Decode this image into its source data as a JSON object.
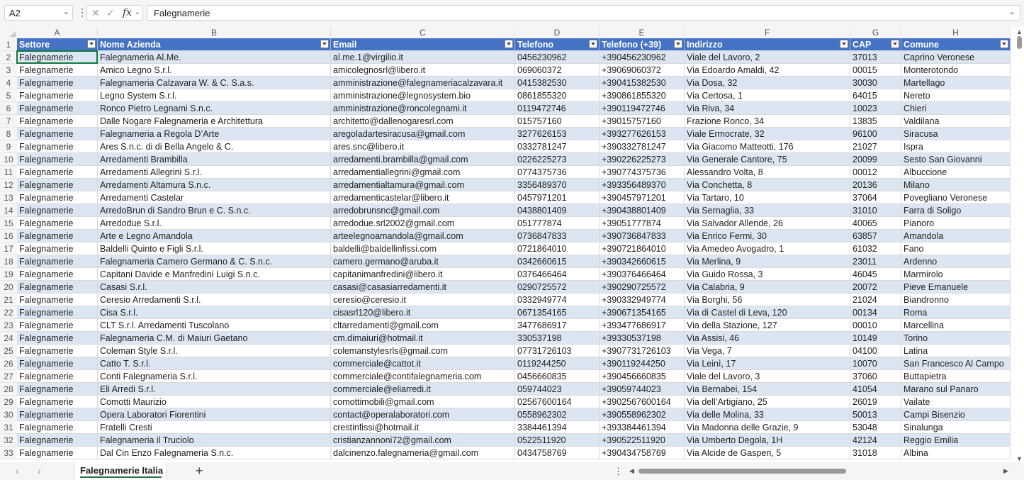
{
  "name_box": "A2",
  "formula_text": "Falegnamerie",
  "formula_icons": [
    "cancel-icon",
    "confirm-icon",
    "fx-icon"
  ],
  "column_letters": [
    "A",
    "B",
    "C",
    "D",
    "E",
    "F",
    "G",
    "H"
  ],
  "headers": [
    "Settore",
    "Nome Azienda",
    "Email",
    "Telefono",
    "Telefono (+39)",
    "Indirizzo",
    "CAP",
    "Comune"
  ],
  "rows": [
    [
      "Falegnamerie",
      "Falegnameria Al.Me.",
      "al.me.1@virgilio.it",
      "0456230962",
      "+390456230962",
      "Viale del Lavoro, 2",
      "37013",
      "Caprino Veronese"
    ],
    [
      "Falegnamerie",
      "Amico Legno S.r.l.",
      "amicolegnosrl@libero.it",
      "069060372",
      "+39069060372",
      "Via Edoardo Amaldi, 42",
      "00015",
      "Monterotondo"
    ],
    [
      "Falegnamerie",
      "Falegnameria Calzavara W. & C. S.a.s.",
      "amministrazione@falegnameriacalzavara.it",
      "0415382530",
      "+390415382530",
      "Via Dosa, 32",
      "30030",
      "Martellago"
    ],
    [
      "Falegnamerie",
      "Legno System S.r.l.",
      "amministrazione@legnosystem.bio",
      "0861855320",
      "+390861855320",
      "Via Certosa, 1",
      "64015",
      "Nereto"
    ],
    [
      "Falegnamerie",
      "Ronco Pietro Legnami S.n.c.",
      "amministrazione@roncolegnami.it",
      "0119472746",
      "+390119472746",
      "Via Riva, 34",
      "10023",
      "Chieri"
    ],
    [
      "Falegnamerie",
      "Dalle Nogare Falegnameria e Architettura",
      "architetto@dallenogaresrl.com",
      "015757160",
      "+39015757160",
      "Frazione Ronco, 34",
      "13835",
      "Valdilana"
    ],
    [
      "Falegnamerie",
      "Falegnameria a Regola D’Arte",
      "aregoladartesiracusa@gmail.com",
      "3277626153",
      "+393277626153",
      "Viale Ermocrate, 32",
      "96100",
      "Siracusa"
    ],
    [
      "Falegnamerie",
      "Ares S.n.c. di di Bella Angelo & C.",
      "ares.snc@libero.it",
      "0332781247",
      "+390332781247",
      "Via Giacomo Matteotti, 176",
      "21027",
      "Ispra"
    ],
    [
      "Falegnamerie",
      "Arredamenti Brambilla",
      "arredamenti.brambilla@gmail.com",
      "0226225273",
      "+390226225273",
      "Via Generale Cantore, 75",
      "20099",
      "Sesto San Giovanni"
    ],
    [
      "Falegnamerie",
      "Arredamenti Allegrini S.r.l.",
      "arredamentiallegrini@gmail.com",
      "0774375736",
      "+390774375736",
      "Alessandro Volta, 8",
      "00012",
      "Albuccione"
    ],
    [
      "Falegnamerie",
      "Arredamenti Altamura S.n.c.",
      "arredamentialtamura@gmail.com",
      "3356489370",
      "+393356489370",
      "Via Conchetta, 8",
      "20136",
      "Milano"
    ],
    [
      "Falegnamerie",
      "Arredamenti Castelar",
      "arredamenticastelar@libero.it",
      "0457971201",
      "+390457971201",
      "Via Tartaro, 10",
      "37064",
      "Povegliano Veronese"
    ],
    [
      "Falegnamerie",
      "ArredoBrun di Sandro Brun e C. S.n.c.",
      "arredobrunsnc@gmail.com",
      "0438801409",
      "+390438801409",
      "Via Sernaglia, 33",
      "31010",
      "Farra di Soligo"
    ],
    [
      "Falegnamerie",
      "Arredodue S.r.l.",
      "arredodue.srl2002@gmail.com",
      "051777874",
      "+39051777874",
      "Via Salvador Allende, 26",
      "40065",
      "Pianoro"
    ],
    [
      "Falegnamerie",
      "Arte e Legno Amandola",
      "arteelegnoamandola@gmail.com",
      "0736847833",
      "+390736847833",
      "Via Enrico Fermi, 30",
      "63857",
      "Amandola"
    ],
    [
      "Falegnamerie",
      "Baldelli Quinto e Figli S.r.l.",
      "baldelli@baldellinfissi.com",
      "0721864010",
      "+390721864010",
      "Via Amedeo Avogadro, 1",
      "61032",
      "Fano"
    ],
    [
      "Falegnamerie",
      "Falegnameria Camero Germano & C. S.n.c.",
      "camero.germano@aruba.it",
      "0342660615",
      "+390342660615",
      "Via Merlina, 9",
      "23011",
      "Ardenno"
    ],
    [
      "Falegnamerie",
      "Capitani Davide e Manfredini Luigi S.n.c.",
      "capitanimanfredini@libero.it",
      "0376466464",
      "+390376466464",
      "Via Guido Rossa, 3",
      "46045",
      "Marmirolo"
    ],
    [
      "Falegnamerie",
      "Casasi S.r.l.",
      "casasi@casasiarredamenti.it",
      "0290725572",
      "+390290725572",
      "Via Calabria, 9",
      "20072",
      "Pieve Emanuele"
    ],
    [
      "Falegnamerie",
      "Ceresio Arredamenti S.r.l.",
      "ceresio@ceresio.it",
      "0332949774",
      "+390332949774",
      "Via Borghi, 56",
      "21024",
      "Biandronno"
    ],
    [
      "Falegnamerie",
      "Cisa S.r.l.",
      "cisasrl120@libero.it",
      "0671354165",
      "+390671354165",
      "Via di Castel di Leva, 120",
      "00134",
      "Roma"
    ],
    [
      "Falegnamerie",
      "CLT S.r.l. Arredamenti Tuscolano",
      "cltarredamenti@gmail.com",
      "3477686917",
      "+393477686917",
      "Via della Stazione, 127",
      "00010",
      "Marcellina"
    ],
    [
      "Falegnamerie",
      "Falegnameria C.M. di Maiuri Gaetano",
      "cm.dimaiuri@hotmail.it",
      "330537198",
      "+39330537198",
      "Via Assisi, 46",
      "10149",
      "Torino"
    ],
    [
      "Falegnamerie",
      "Coleman Style S.r.l.",
      "colemanstylesrls@gmail.com",
      "07731726103",
      "+3907731726103",
      "Via Vega, 7",
      "04100",
      "Latina"
    ],
    [
      "Falegnamerie",
      "Catto T. S.r.l.",
      "commerciale@cattot.it",
      "0119244250",
      "+390119244250",
      "Via Leinì, 17",
      "10070",
      "San Francesco Al Campo"
    ],
    [
      "Falegnamerie",
      "Conti Falegnameria S.r.l.",
      "commerciale@contifalegnameria.com",
      "0456660835",
      "+390456660835",
      "Viale del Lavoro, 3",
      "37060",
      "Buttapietra"
    ],
    [
      "Falegnamerie",
      "Eli Arredi S.r.l.",
      "commerciale@eliarredi.it",
      "059744023",
      "+39059744023",
      "Via Bernabei, 154",
      "41054",
      "Marano sul Panaro"
    ],
    [
      "Falegnamerie",
      "Comotti Maurizio",
      "comottimobili@gmail.com",
      "02567600164",
      "+3902567600164",
      "Via dell’Artigiano, 25",
      "26019",
      "Vailate"
    ],
    [
      "Falegnamerie",
      "Opera Laboratori Fiorentini",
      "contact@operalaboratori.com",
      "0558962302",
      "+390558962302",
      "Via delle Molina, 33",
      "50013",
      "Campi Bisenzio"
    ],
    [
      "Falegnamerie",
      "Fratelli Cresti",
      "crestinfissi@hotmail.it",
      "3384461394",
      "+393384461394",
      "Via Madonna delle Grazie, 9",
      "53048",
      "Sinalunga"
    ],
    [
      "Falegnamerie",
      "Falegnameria il Truciolo",
      "cristianzannoni72@gmail.com",
      "0522511920",
      "+390522511920",
      "Via Umberto Degola, 1H",
      "42124",
      "Reggio Emilia"
    ],
    [
      "Falegnamerie",
      "Dal Cin Enzo Falegnameria S.n.c.",
      "dalcinenzo.falegnameria@gmail.com",
      "0434758769",
      "+390434758769",
      "Via Alcide de Gasperi, 5",
      "31018",
      "Albina"
    ]
  ],
  "sheet_tab": "Falegnamerie Italia",
  "colors": {
    "header_fill": "#4472c4",
    "band_fill": "#dce6f2",
    "tab_accent": "#217346"
  }
}
